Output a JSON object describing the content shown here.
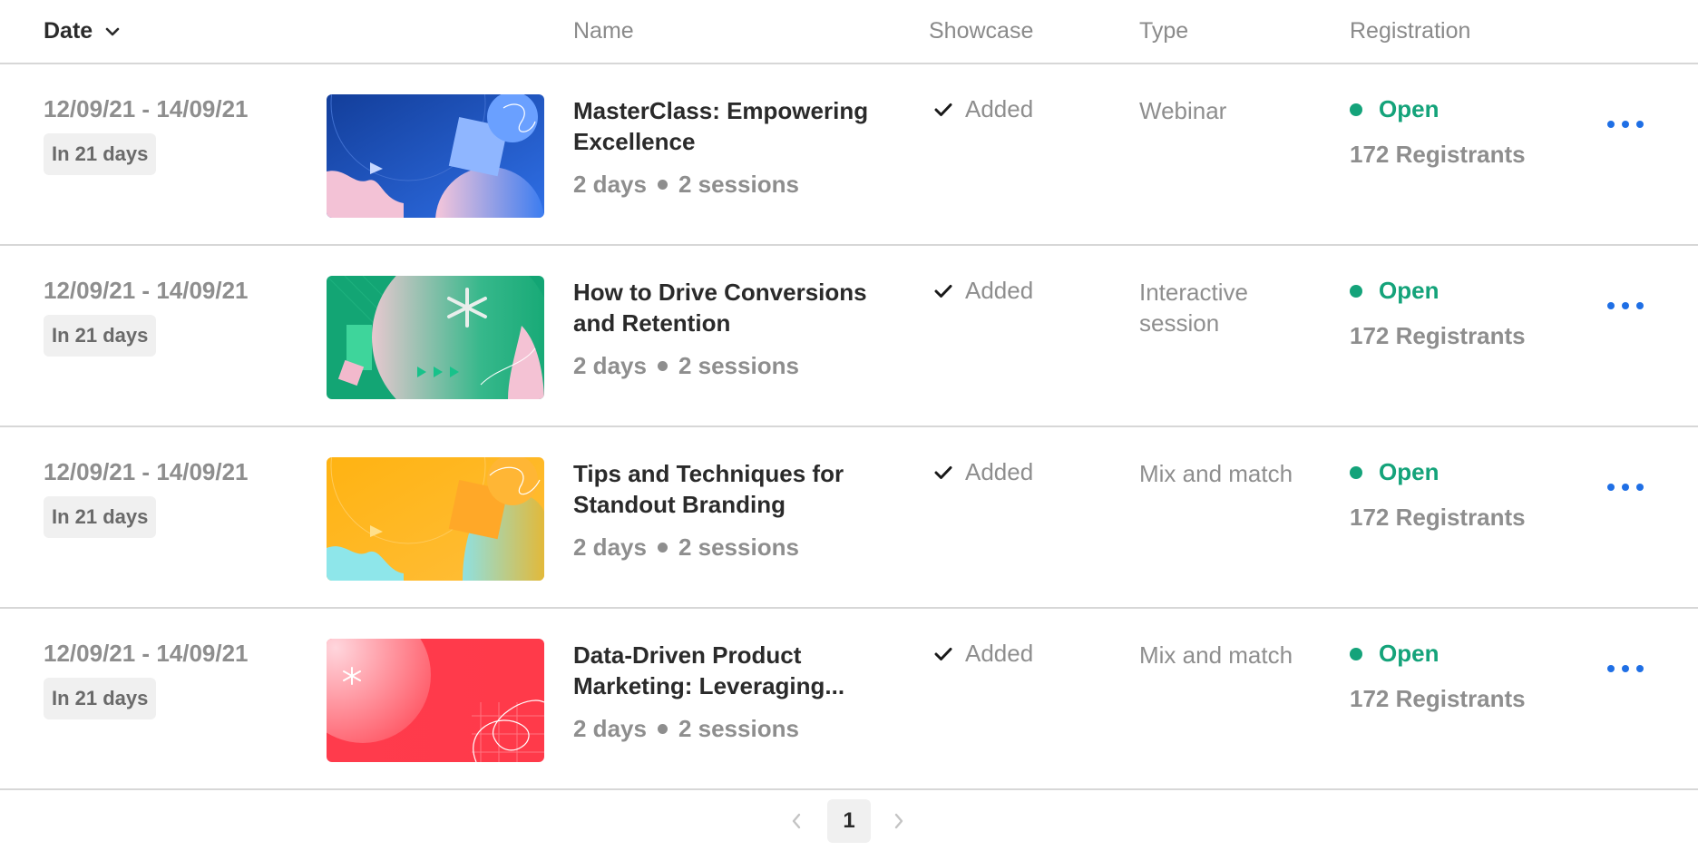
{
  "header": {
    "date_label": "Date",
    "name_label": "Name",
    "showcase_label": "Showcase",
    "type_label": "Type",
    "registration_label": "Registration"
  },
  "colors": {
    "accent_blue": "#1f6fe5",
    "status_open": "#14a37a",
    "divider": "#d7d7d7",
    "muted_text": "#8e8e8e"
  },
  "rows": [
    {
      "date_range": "12/09/21 - 14/09/21",
      "relative": "In 21 days",
      "title": "MasterClass: Empowering Excellence",
      "duration": "2 days",
      "sessions": "2 sessions",
      "showcase": "Added",
      "type": "Webinar",
      "status": "Open",
      "registrants": "172 Registrants",
      "thumb_theme": "blue"
    },
    {
      "date_range": "12/09/21 - 14/09/21",
      "relative": "In 21 days",
      "title": "How to Drive Conversions and Retention",
      "duration": "2 days",
      "sessions": "2 sessions",
      "showcase": "Added",
      "type": "Interactive session",
      "status": "Open",
      "registrants": "172 Registrants",
      "thumb_theme": "green"
    },
    {
      "date_range": "12/09/21 - 14/09/21",
      "relative": "In 21 days",
      "title": "Tips and Techniques for Standout Branding",
      "duration": "2 days",
      "sessions": "2 sessions",
      "showcase": "Added",
      "type": "Mix and match",
      "status": "Open",
      "registrants": "172 Registrants",
      "thumb_theme": "orange"
    },
    {
      "date_range": "12/09/21 - 14/09/21",
      "relative": "In 21 days",
      "title": "Data-Driven Product Marketing: Leveraging...",
      "duration": "2 days",
      "sessions": "2 sessions",
      "showcase": "Added",
      "type": "Mix and match",
      "status": "Open",
      "registrants": "172 Registrants",
      "thumb_theme": "red"
    }
  ],
  "pagination": {
    "current_page": "1"
  },
  "icons": {
    "sort": "chevron-down-icon",
    "showcase": "check-icon",
    "row_menu": "more-horizontal-icon",
    "prev": "chevron-left-icon",
    "next": "chevron-right-icon"
  }
}
